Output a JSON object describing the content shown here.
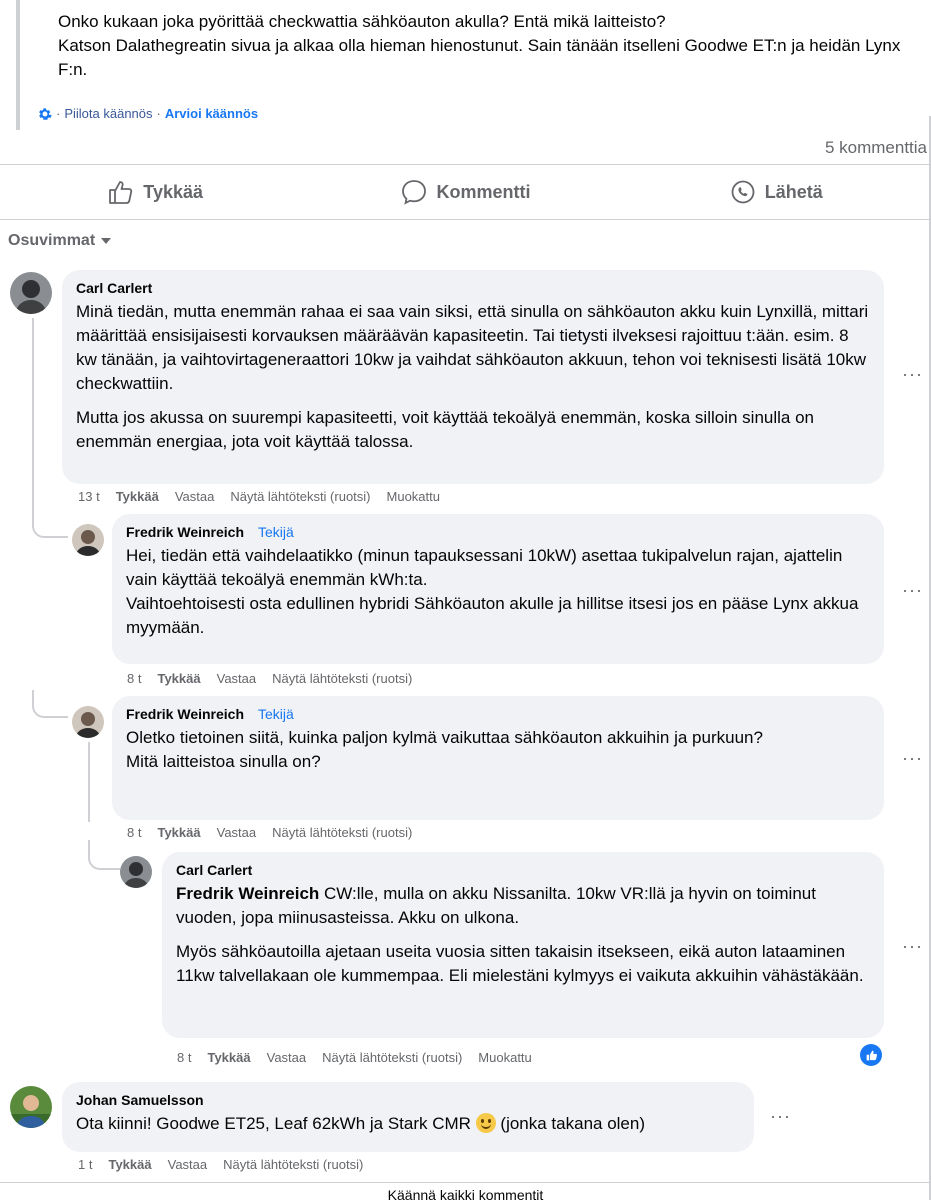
{
  "post": {
    "lines": [
      "Onko kukaan joka pyörittää checkwattia sähköauton akulla? Entä mikä laitteisto?",
      "Katson Dalathegreatin sivua ja alkaa olla hieman hienostunut. Sain tänään itselleni Goodwe ET:n ja heidän Lynx F:n."
    ],
    "hide_translation": "Piilota käännös",
    "rate_translation": "Arvioi käännös",
    "separator": "·"
  },
  "comment_count": "5 kommenttia",
  "actions": {
    "like": "Tykkää",
    "comment": "Kommentti",
    "share": "Lähetä"
  },
  "sort_label": "Osuvimmat",
  "comments": [
    {
      "author": "Carl Carlert",
      "paragraphs": [
        "Minä tiedän, mutta enemmän rahaa ei saa vain siksi, että sinulla on sähköauton akku kuin Lynxillä, mittari määrittää ensisijaisesti korvauksen määräävän kapasiteetin. Tai tietysti ilveksesi rajoittuu t:ään. esim. 8 kw tänään, ja vaihtovirtageneraattori 10kw ja vaihdat sähköauton akkuun, tehon voi teknisesti lisätä 10kw checkwattiin.",
        "Mutta jos akussa on suurempi kapasiteetti, voit käyttää tekoälyä enemmän, koska silloin sinulla on enemmän energiaa, jota voit käyttää talossa."
      ],
      "time": "13 t",
      "like": "Tykkää",
      "reply": "Vastaa",
      "source": "Näytä lähtöteksti (ruotsi)",
      "edited": "Muokattu"
    },
    {
      "author": "Fredrik Weinreich",
      "badge": "Tekijä",
      "paragraphs": [
        "Hei, tiedän että vaihdelaatikko (minun tapauksessani 10kW) asettaa tukipalvelun rajan, ajattelin vain käyttää tekoälyä enemmän kWh:ta.\nVaihtoehtoisesti osta edullinen hybridi Sähköauton akulle ja hillitse itsesi jos en pääse Lynx akkua myymään."
      ],
      "time": "8 t",
      "like": "Tykkää",
      "reply": "Vastaa",
      "source": "Näytä lähtöteksti (ruotsi)"
    },
    {
      "author": "Fredrik Weinreich",
      "badge": "Tekijä",
      "paragraphs": [
        "Oletko tietoinen siitä, kuinka paljon kylmä vaikuttaa sähköauton akkuihin ja purkuun?\nMitä laitteistoa sinulla on?"
      ],
      "time": "8 t",
      "like": "Tykkää",
      "reply": "Vastaa",
      "source": "Näytä lähtöteksti (ruotsi)"
    },
    {
      "author": "Carl Carlert",
      "mention": "Fredrik Weinreich",
      "paragraphs": [
        " CW:lle, mulla on akku Nissanilta. 10kw VR:llä ja hyvin on toiminut vuoden, jopa miinusasteissa. Akku on ulkona.",
        "Myös sähköautoilla ajetaan useita vuosia sitten takaisin itsekseen, eikä auton lataaminen 11kw talvellakaan ole kummempaa. Eli mielestäni kylmyys ei vaikuta akkuihin vähästäkään."
      ],
      "time": "8 t",
      "like": "Tykkää",
      "reply": "Vastaa",
      "source": "Näytä lähtöteksti (ruotsi)",
      "edited": "Muokattu"
    },
    {
      "author": "Johan Samuelsson",
      "paragraphs": [
        "Ota kiinni! Goodwe ET25, Leaf 62kWh ja Stark CMR",
        " (jonka takana olen)"
      ],
      "time": "1 t",
      "like": "Tykkää",
      "reply": "Vastaa",
      "source": "Näytä lähtöteksti (ruotsi)"
    }
  ],
  "more_glyph": "···",
  "footer": "Käännä kaikki kommentit",
  "colors": {
    "accent": "#1877f2",
    "bubble": "#f0f2f5",
    "muted": "#65676b"
  }
}
